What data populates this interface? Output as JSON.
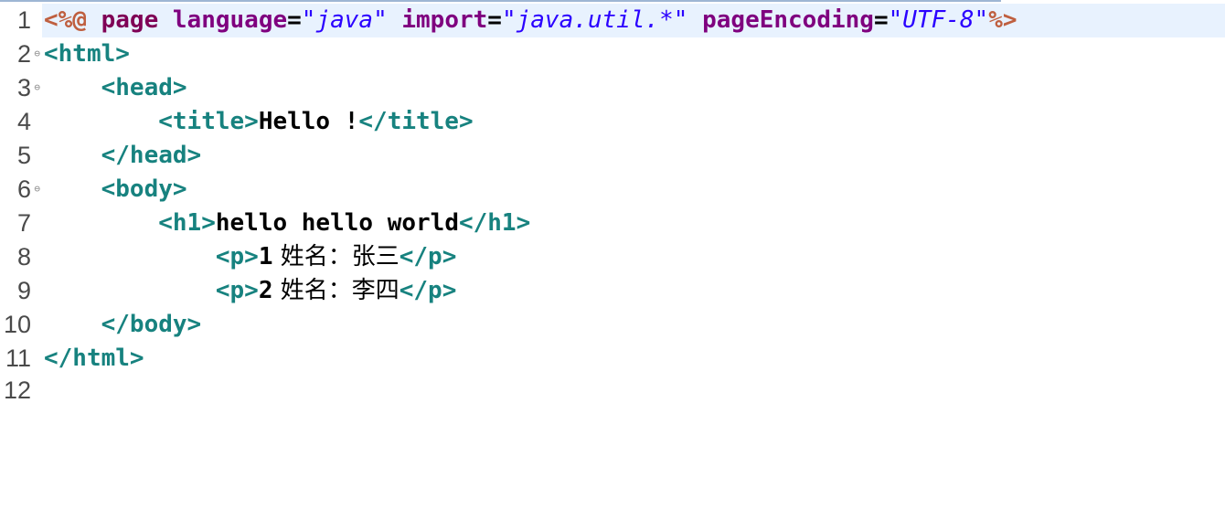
{
  "editor": {
    "lines": [
      {
        "num": "1",
        "fold": false,
        "current": true
      },
      {
        "num": "2",
        "fold": true
      },
      {
        "num": "3",
        "fold": true
      },
      {
        "num": "4",
        "fold": false
      },
      {
        "num": "5",
        "fold": false
      },
      {
        "num": "6",
        "fold": true
      },
      {
        "num": "7",
        "fold": false
      },
      {
        "num": "8",
        "fold": false
      },
      {
        "num": "9",
        "fold": false
      },
      {
        "num": "10",
        "fold": false
      },
      {
        "num": "11",
        "fold": false
      },
      {
        "num": "12",
        "fold": false
      }
    ],
    "fold_icon": "⊖",
    "code": {
      "l1": {
        "open": "<%@",
        "page": " page",
        "a1": " language",
        "eq": "=",
        "v1": "\"java\"",
        "a2": " import",
        "v2": "\"java.util.*\"",
        "a3": " pageEncoding",
        "v3": "\"UTF-8\"",
        "close": "%>"
      },
      "l2": {
        "tag": "<html>"
      },
      "l3": {
        "indent": "    ",
        "tag": "<head>"
      },
      "l4": {
        "indent": "        ",
        "open": "<title>",
        "text": "Hello !",
        "close": "</title>"
      },
      "l5": {
        "indent": "    ",
        "tag": "</head>"
      },
      "l6": {
        "indent": "    ",
        "tag": "<body>"
      },
      "l7": {
        "indent": "        ",
        "open": "<h1>",
        "text": "hello hello world",
        "close": "</h1>"
      },
      "l8": {
        "indent": "            ",
        "open": "<p>",
        "num": "1",
        "text": " 姓名：张三",
        "close": "</p>"
      },
      "l9": {
        "indent": "            ",
        "open": "<p>",
        "num": "2",
        "text": " 姓名：李四",
        "close": "</p>"
      },
      "l10": {
        "indent": "    ",
        "tag": "</body>"
      },
      "l11": {
        "tag": "</html>"
      }
    }
  },
  "colors": {
    "tag": "#17827f",
    "directive": "#bf5f3f",
    "keyword": "#7f0055",
    "attribute": "#7f007f",
    "string": "#2a00ff",
    "current_line": "#e8f2fe"
  }
}
